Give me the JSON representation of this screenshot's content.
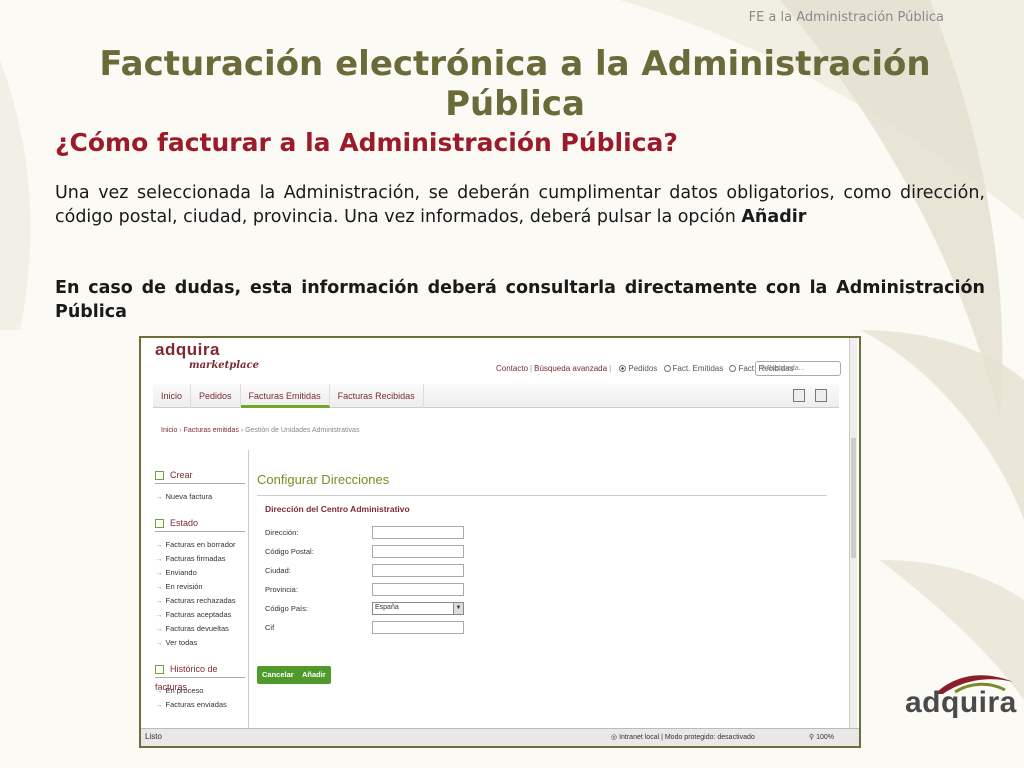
{
  "header_tag": "FE a la Administración Pública",
  "title": "Facturación electrónica a la Administración Pública",
  "subtitle": "¿Cómo facturar a la Administración Pública?",
  "paragraph1_text": "Una vez seleccionada la Administración, se deberán cumplimentar  datos obligatorios, como dirección, código postal, ciudad, provincia. Una vez informados, deberá pulsar la opción ",
  "paragraph1_bold": "Añadir",
  "paragraph2": "En caso de dudas, esta información deberá consultarla  directamente con la Administración Pública",
  "screenshot": {
    "logo": "adquira",
    "logo_sub": "marketplace",
    "top_links": {
      "contacto": "Contacto",
      "busqueda": "Búsqueda avanzada",
      "radio_pedidos": "Pedidos",
      "radio_emitidas": "Fact. Emitidas",
      "radio_recibidas": "Fact. Recibidas",
      "search_placeholder": "Búsqueda..."
    },
    "tabs": [
      "Inicio",
      "Pedidos",
      "Facturas Emitidas",
      "Facturas Recibidas"
    ],
    "breadcrumb": {
      "inicio": "Inicio",
      "facturas": "Facturas emitidas",
      "current": "Gestión de Unidades Administrativas"
    },
    "sidebar": {
      "crear_head": "Crear",
      "nueva_factura": "Nueva factura",
      "estado_head": "Estado",
      "estado_items": [
        "Facturas en borrador",
        "Facturas firmadas",
        "Enviando",
        "En revisión",
        "Facturas rechazadas",
        "Facturas aceptadas",
        "Facturas devueltas",
        "Ver todas"
      ],
      "historico_head": "Histórico de facturas",
      "historico_items": [
        "En proceso",
        "Facturas enviadas"
      ]
    },
    "panel_title": "Configurar Direcciones",
    "panel_subtitle": "Dirección del Centro Administrativo",
    "form": {
      "direccion_label": "Dirección:",
      "cp_label": "Código Postal:",
      "ciudad_label": "Ciudad:",
      "provincia_label": "Provincia:",
      "pais_label": "Código País:",
      "pais_value": "España",
      "cif_label": "Cif"
    },
    "cancel_button": "Cancelar",
    "add_button": "Añadir",
    "status_left": "Listo",
    "status_zone": "Intranet local | Modo protegido: desactivado",
    "status_zoom": "100%"
  },
  "corner_logo": "adquira",
  "colors": {
    "title": "#6b6b3a",
    "subtitle": "#9b1b2a",
    "button_green": "#4f9a2a",
    "brand": "#7d2a33"
  }
}
